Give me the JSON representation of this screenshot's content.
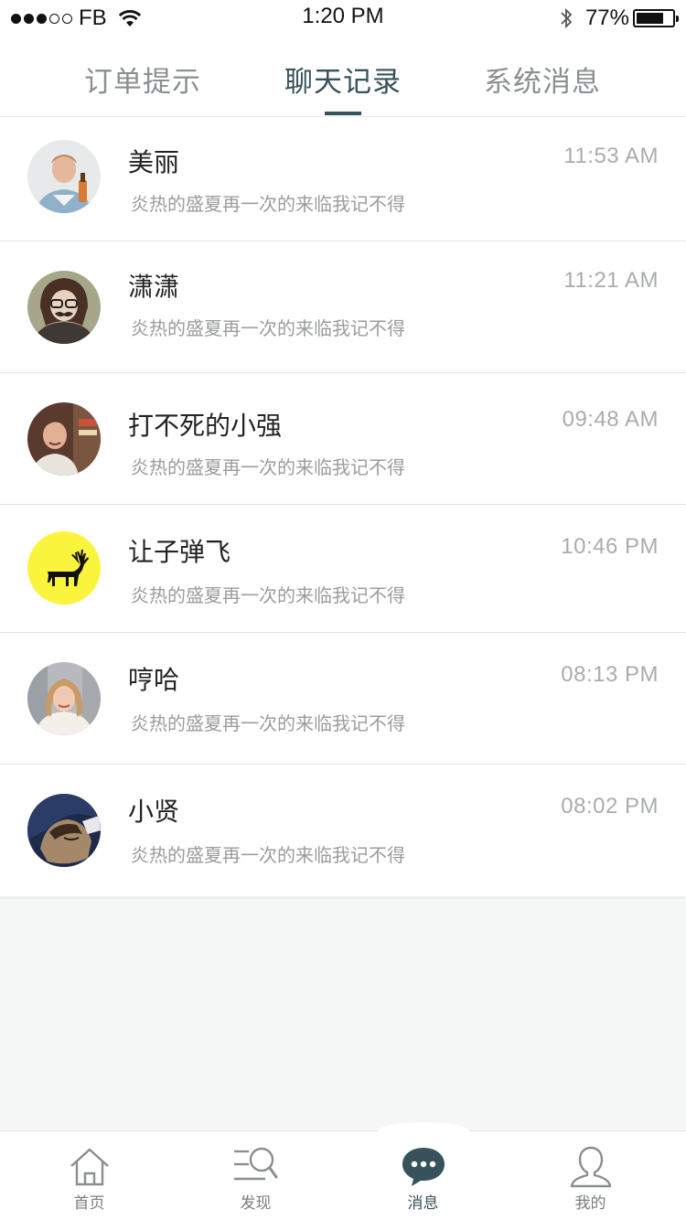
{
  "status_bar": {
    "carrier": "FB",
    "signal_bars": 3,
    "signal_total": 5,
    "time": "1:20 PM",
    "battery_percent": "77%",
    "battery_level": 0.77
  },
  "header_tabs": [
    {
      "label": "订单提示",
      "active": false
    },
    {
      "label": "聊天记录",
      "active": true
    },
    {
      "label": "系统消息",
      "active": false
    }
  ],
  "chats": [
    {
      "name": "美丽",
      "time": "11:53 AM",
      "preview": "炎热的盛夏再一次的来临我记不得"
    },
    {
      "name": "潇潇",
      "time": "11:21 AM",
      "preview": "炎热的盛夏再一次的来临我记不得"
    },
    {
      "name": "打不死的小强",
      "time": "09:48 AM",
      "preview": "炎热的盛夏再一次的来临我记不得"
    },
    {
      "name": "让子弹飞",
      "time": "10:46 PM",
      "preview": "炎热的盛夏再一次的来临我记不得"
    },
    {
      "name": "哼哈",
      "time": "08:13 PM",
      "preview": "炎热的盛夏再一次的来临我记不得"
    },
    {
      "name": "小贤",
      "time": "08:02 PM",
      "preview": "炎热的盛夏再一次的来临我记不得"
    }
  ],
  "tab_bar": [
    {
      "label": "首页",
      "icon": "home-icon",
      "active": false
    },
    {
      "label": "发现",
      "icon": "discover-icon",
      "active": false
    },
    {
      "label": "消息",
      "icon": "chat-bubble-icon",
      "active": true
    },
    {
      "label": "我的",
      "icon": "profile-icon",
      "active": false
    }
  ],
  "colors": {
    "accent": "#37525b",
    "inactive_text": "#8a8f92",
    "background": "#f5f6f6"
  }
}
